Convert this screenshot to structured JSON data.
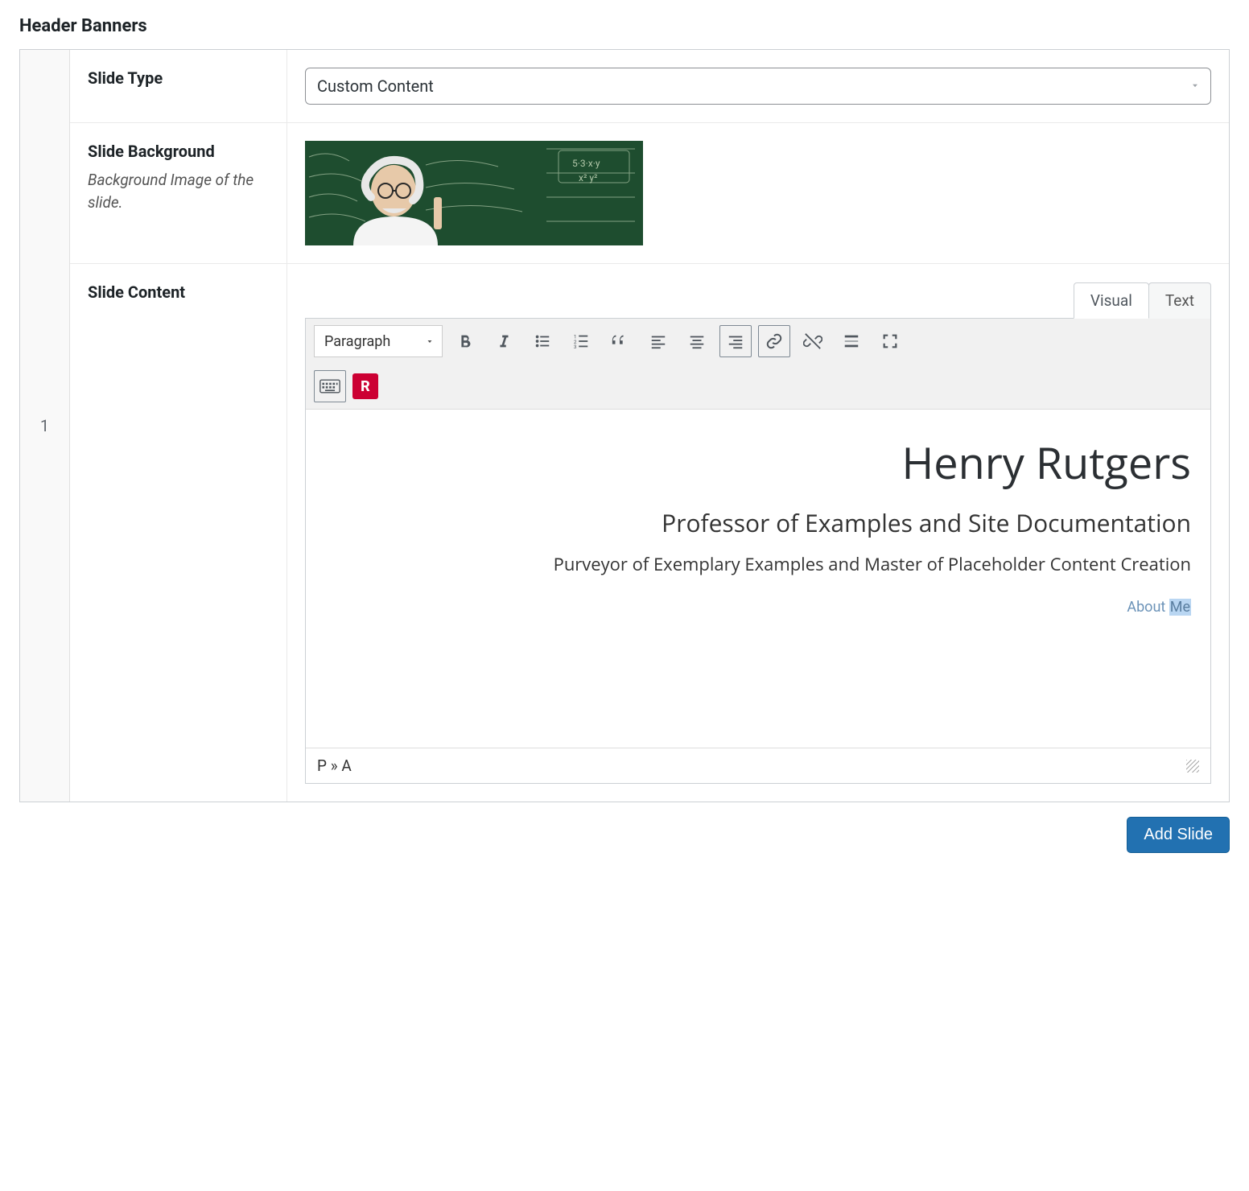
{
  "section_title": "Header Banners",
  "row_number": "1",
  "fields": {
    "slide_type": {
      "label": "Slide Type",
      "selected": "Custom Content"
    },
    "slide_background": {
      "label": "Slide Background",
      "description": "Background Image of the slide."
    },
    "slide_content": {
      "label": "Slide Content"
    }
  },
  "editor": {
    "tabs": {
      "visual": "Visual",
      "text": "Text",
      "active": "visual"
    },
    "format_selected": "Paragraph",
    "toolbar_icons": {
      "bold": "bold-icon",
      "italic": "italic-icon",
      "ul": "bulleted-list-icon",
      "ol": "numbered-list-icon",
      "quote": "blockquote-icon",
      "align_left": "align-left-icon",
      "align_center": "align-center-icon",
      "align_right": "align-right-icon",
      "link": "link-icon",
      "unlink": "unlink-icon",
      "readmore": "read-more-icon",
      "fullscreen": "fullscreen-icon",
      "keyboard": "keyboard-icon",
      "rutgers": "R"
    },
    "content": {
      "heading": "Henry Rutgers",
      "subheading": "Professor of Examples and Site Documentation",
      "tagline": "Purveyor of Exemplary Examples and Master of Placeholder Content Creation",
      "link_text_a": "About ",
      "link_text_b": "Me"
    },
    "breadcrumb": "P » A"
  },
  "buttons": {
    "add_slide": "Add Slide"
  }
}
